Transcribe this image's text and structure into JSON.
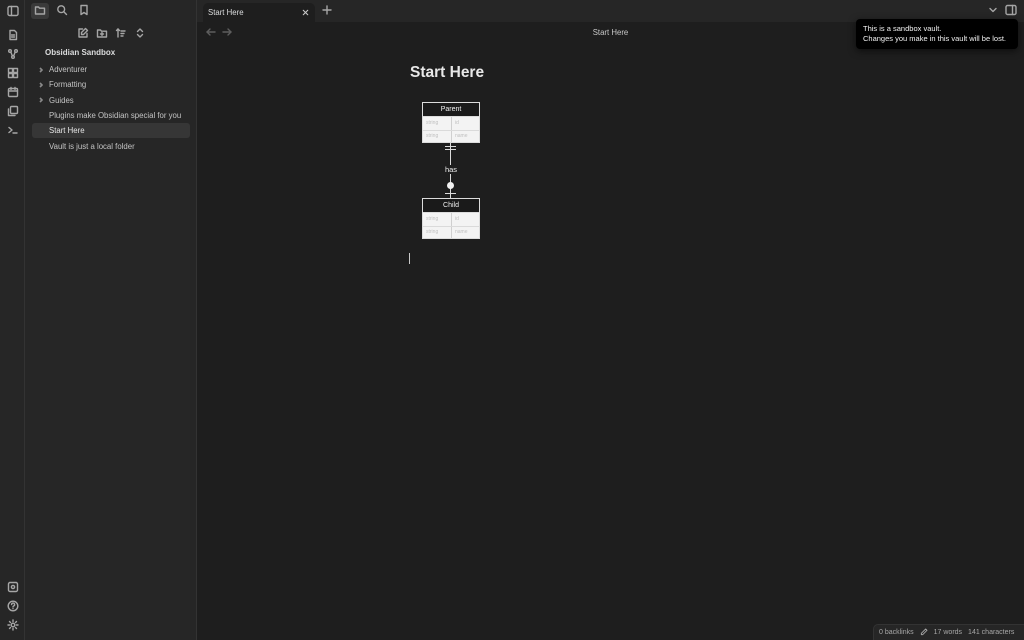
{
  "ribbon": {
    "icons": [
      "daily-note-icon",
      "graph-icon",
      "canvas-icon",
      "calendar-icon",
      "templates-icon",
      "terminal-icon"
    ],
    "bottom_icons": [
      "vault-switcher-icon",
      "help-icon",
      "settings-icon"
    ]
  },
  "sidebar": {
    "vault_name": "Obsidian Sandbox",
    "items": [
      {
        "label": "Adventurer",
        "type": "folder"
      },
      {
        "label": "Formatting",
        "type": "folder"
      },
      {
        "label": "Guides",
        "type": "folder"
      },
      {
        "label": "Plugins make Obsidian special for you",
        "type": "file"
      },
      {
        "label": "Start Here",
        "type": "file",
        "active": true
      },
      {
        "label": "Vault is just a local folder",
        "type": "file"
      }
    ]
  },
  "tabs": {
    "active_label": "Start Here"
  },
  "editor": {
    "view_title": "Start Here",
    "doc_title": "Start Here"
  },
  "diagram": {
    "parent": {
      "name": "Parent",
      "rows": [
        [
          "string",
          "id"
        ],
        [
          "string",
          "name"
        ]
      ]
    },
    "child": {
      "name": "Child",
      "rows": [
        [
          "string",
          "id"
        ],
        [
          "string",
          "name"
        ]
      ]
    },
    "relation_label": "has"
  },
  "notice": {
    "line1": "This is a sandbox vault.",
    "line2": "Changes you make in this vault will be lost."
  },
  "status": {
    "backlinks": "0 backlinks",
    "words": "17 words",
    "characters": "141 characters"
  },
  "colors": {
    "background": "#1e1e1e",
    "sidebar": "#262626",
    "active_item": "#363636",
    "text": "#dcddde"
  }
}
